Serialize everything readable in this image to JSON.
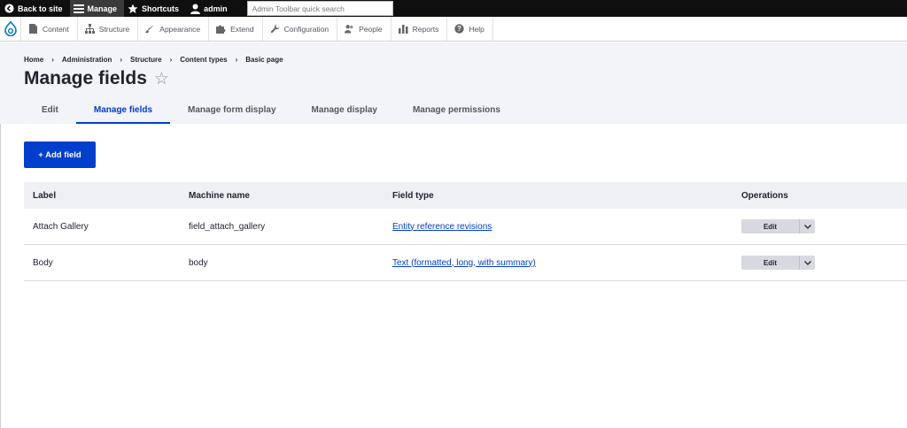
{
  "toolbar": {
    "back_label": "Back to site",
    "manage_label": "Manage",
    "shortcuts_label": "Shortcuts",
    "user_label": "admin",
    "search_placeholder": "Admin Toolbar quick search"
  },
  "tray": {
    "items": [
      {
        "label": "Content",
        "icon": "document-icon"
      },
      {
        "label": "Structure",
        "icon": "structure-icon"
      },
      {
        "label": "Appearance",
        "icon": "paintbrush-icon"
      },
      {
        "label": "Extend",
        "icon": "puzzle-icon"
      },
      {
        "label": "Configuration",
        "icon": "wrench-icon"
      },
      {
        "label": "People",
        "icon": "people-icon"
      },
      {
        "label": "Reports",
        "icon": "bar-chart-icon"
      },
      {
        "label": "Help",
        "icon": "help-icon"
      }
    ]
  },
  "breadcrumb": [
    "Home",
    "Administration",
    "Structure",
    "Content types",
    "Basic page"
  ],
  "page": {
    "title": "Manage fields",
    "star": "☆"
  },
  "tabs": [
    {
      "label": "Edit",
      "active": false
    },
    {
      "label": "Manage fields",
      "active": true
    },
    {
      "label": "Manage form display",
      "active": false
    },
    {
      "label": "Manage display",
      "active": false
    },
    {
      "label": "Manage permissions",
      "active": false
    }
  ],
  "add_field_label": "+ Add field",
  "table": {
    "headers": [
      "Label",
      "Machine name",
      "Field type",
      "Operations"
    ],
    "rows": [
      {
        "label": "Attach Gallery",
        "machine": "field_attach_gallery",
        "type": "Entity reference revisions",
        "op": "Edit"
      },
      {
        "label": "Body",
        "machine": "body",
        "type": "Text (formatted, long, with summary)",
        "op": "Edit"
      }
    ]
  },
  "colors": {
    "accent": "#003ecc",
    "toolbar_bg": "#0f0f0f",
    "header_bg": "#f3f4f9"
  }
}
